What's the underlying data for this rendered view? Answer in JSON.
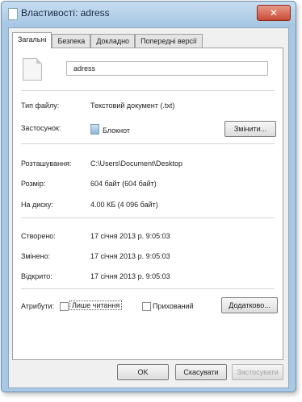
{
  "window": {
    "title": "Властивості: adress",
    "close_label": "✕"
  },
  "tabs": [
    {
      "label": "Загальні",
      "active": true
    },
    {
      "label": "Безпека",
      "active": false
    },
    {
      "label": "Докладно",
      "active": false
    },
    {
      "label": "Попередні версії",
      "active": false
    }
  ],
  "file": {
    "name": "adress",
    "icon": "text-file-icon"
  },
  "type": {
    "label": "Тип файлу:",
    "value": "Текстовий документ (.txt)"
  },
  "app": {
    "label": "Застосунок:",
    "value": "Блокнот",
    "icon": "notepad-icon",
    "change_button": "Змінити..."
  },
  "location": {
    "label": "Розташування:",
    "value": "C:\\Users\\Document\\Desktop"
  },
  "size": {
    "label": "Розмір:",
    "value": "604 байт (604 байт)"
  },
  "disk_size": {
    "label": "На диску:",
    "value": "4.00 КБ (4 096 байт)"
  },
  "created": {
    "label": "Створено:",
    "value": "17 січня 2013 р. 9:05:03"
  },
  "modified": {
    "label": "Змінено:",
    "value": "17 січня 2013 р. 9:05:03"
  },
  "accessed": {
    "label": "Відкрито:",
    "value": "17 січня 2013 р. 9:05:03"
  },
  "attributes": {
    "label": "Атрибути:",
    "readonly_label": "Лише читання",
    "readonly_checked": false,
    "hidden_label": "Прихований",
    "hidden_checked": false,
    "advanced_button": "Додатково..."
  },
  "footer": {
    "ok": "OK",
    "cancel": "Скасувати",
    "apply": "Застосувати"
  },
  "colors": {
    "title_bar": "#a9c8e4",
    "close": "#c84a35",
    "panel": "#ffffff"
  }
}
